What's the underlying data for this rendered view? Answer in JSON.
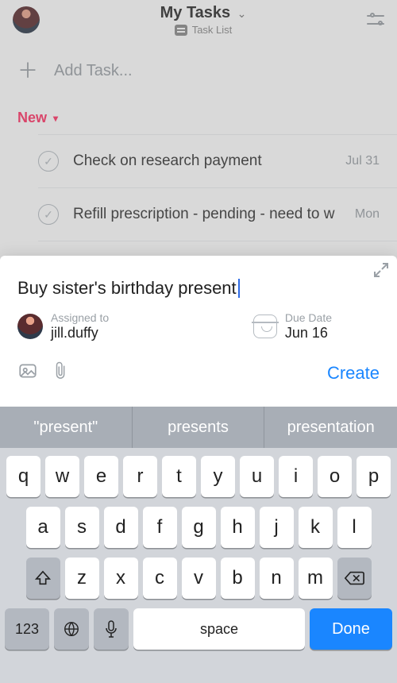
{
  "header": {
    "title": "My Tasks",
    "subtitle": "Task List"
  },
  "addTask": {
    "placeholder": "Add Task..."
  },
  "section": {
    "name": "New"
  },
  "tasks": [
    {
      "title": "Check on research payment",
      "meta": "Jul 31"
    },
    {
      "title": "Refill prescription - pending - need to w",
      "meta": "Mon"
    }
  ],
  "composer": {
    "text": "Buy sister's birthday present",
    "assigned": {
      "label": "Assigned to",
      "value": "jill.duffy"
    },
    "due": {
      "label": "Due Date",
      "value": "Jun 16"
    },
    "createLabel": "Create"
  },
  "keyboard": {
    "suggestions": [
      "\"present\"",
      "presents",
      "presentation"
    ],
    "row1": [
      "q",
      "w",
      "e",
      "r",
      "t",
      "y",
      "u",
      "i",
      "o",
      "p"
    ],
    "row2": [
      "a",
      "s",
      "d",
      "f",
      "g",
      "h",
      "j",
      "k",
      "l"
    ],
    "row3": [
      "z",
      "x",
      "c",
      "v",
      "b",
      "n",
      "m"
    ],
    "numKey": "123",
    "space": "space",
    "done": "Done"
  }
}
